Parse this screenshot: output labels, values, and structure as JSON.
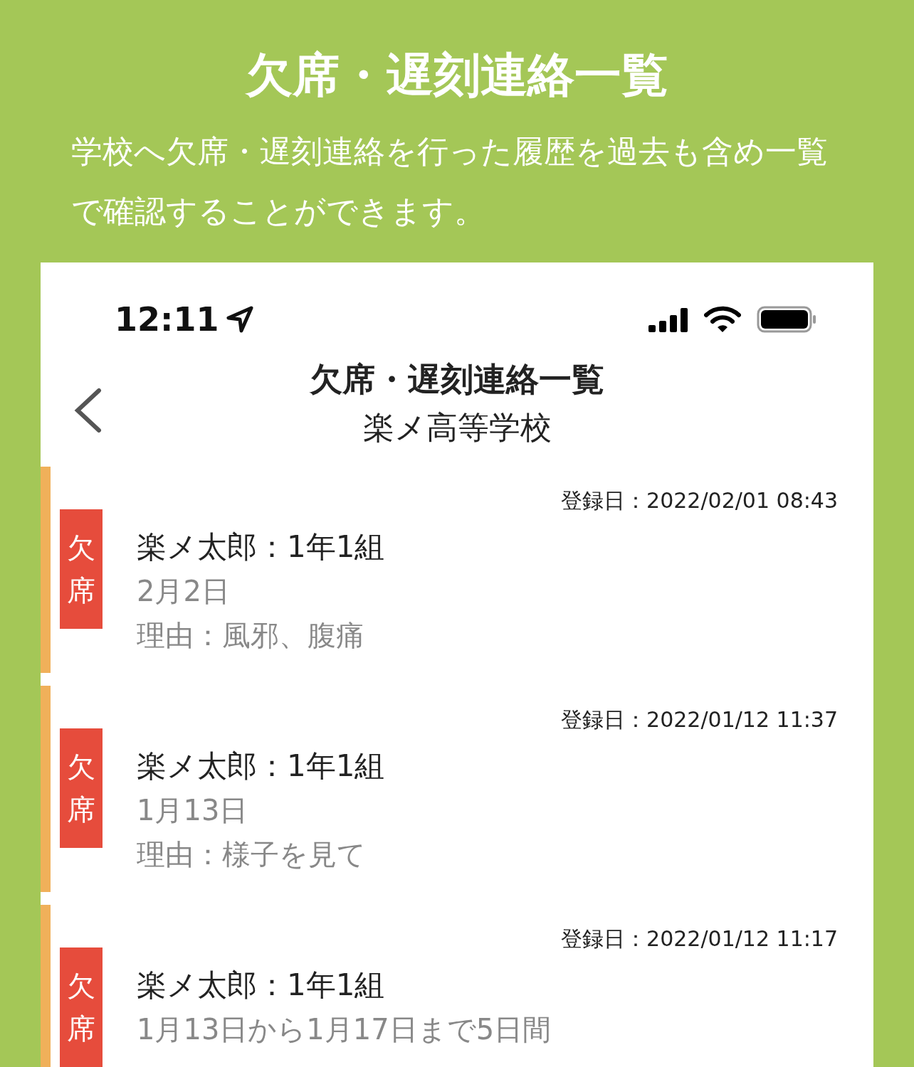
{
  "header": {
    "title": "欠席・遅刻連絡一覧",
    "description": "学校へ欠席・遅刻連絡を行った履歴を過去も含め一覧で確認することができます。"
  },
  "status_bar": {
    "time": "12:11"
  },
  "nav": {
    "title": "欠席・遅刻連絡一覧",
    "subtitle": "楽メ高等学校"
  },
  "records": [
    {
      "kind": "absence",
      "tag": "欠席",
      "registered": "登録日：2022/02/01 08:43",
      "student": "楽メ太郎：1年1組",
      "date": "2月2日",
      "reason": "理由：風邪、腹痛"
    },
    {
      "kind": "absence",
      "tag": "欠席",
      "registered": "登録日：2022/01/12 11:37",
      "student": "楽メ太郎：1年1組",
      "date": "1月13日",
      "reason": "理由：様子を見て"
    },
    {
      "kind": "absence",
      "tag": "欠席",
      "registered": "登録日：2022/01/12 11:17",
      "student": "楽メ太郎：1年1組",
      "date": "1月13日から1月17日まで5日間"
    }
  ]
}
